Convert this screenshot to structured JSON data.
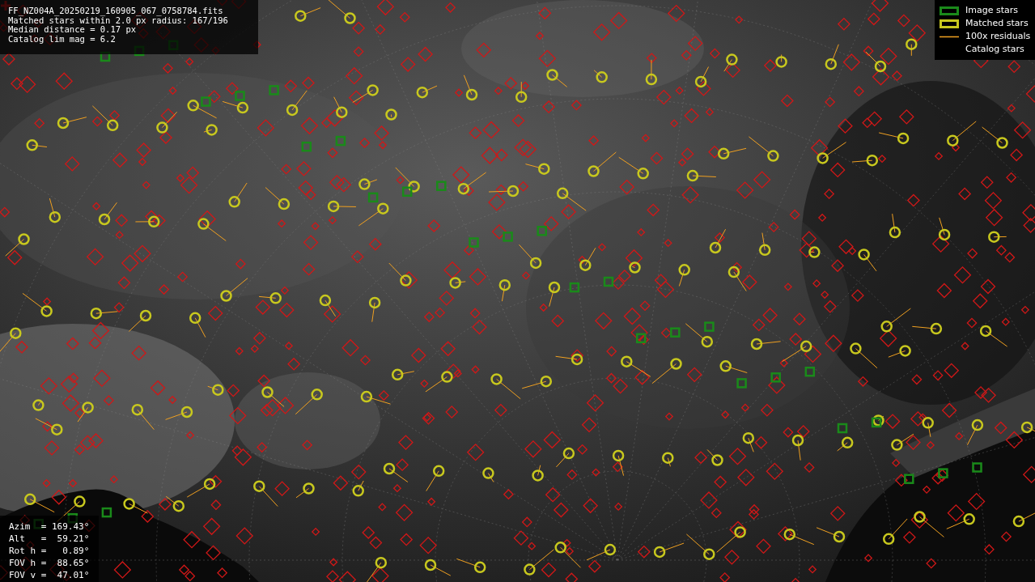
{
  "info_panel": {
    "lines": [
      "FF_NZ004A_20250219_160905_067_0758784.fits",
      "Matched stars within 2.0 px radius: 167/196",
      "Median distance = 0.17 px",
      "Catalog lim mag = 6.2"
    ]
  },
  "legend": [
    {
      "label": "Image stars",
      "kind": "box",
      "color": "#1a8a1a"
    },
    {
      "label": "Matched stars",
      "kind": "box",
      "color": "#c8c81e"
    },
    {
      "label": "100x residuals",
      "kind": "line",
      "color": "#f0a020"
    },
    {
      "label": "Catalog stars",
      "kind": "none"
    }
  ],
  "pointing": {
    "lines": [
      "Azim  = 169.43°",
      "Alt   =  59.21°",
      "Rot h =   0.89°",
      "FOV h =  88.65°",
      "FOV v =  47.01°"
    ]
  }
}
